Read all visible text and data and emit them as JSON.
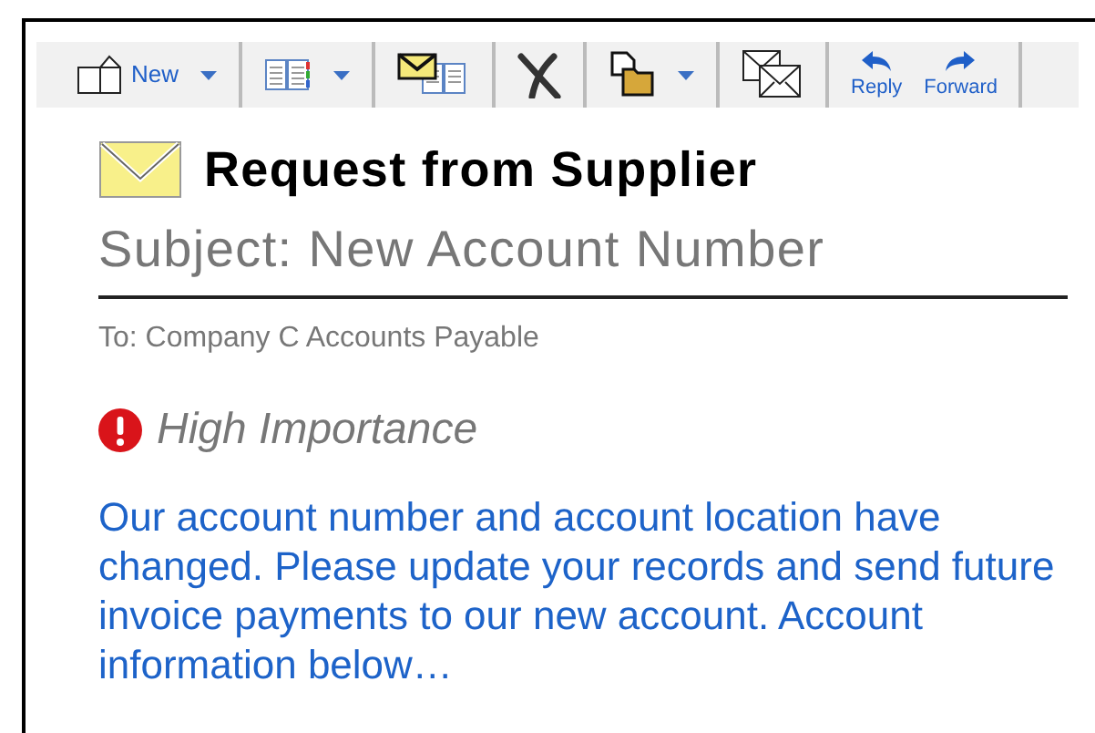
{
  "toolbar": [
    {
      "kind": "new",
      "label": "New",
      "dropdown": true
    },
    {
      "kind": "view",
      "dropdown": true
    },
    {
      "kind": "mailview",
      "dropdown": false
    },
    {
      "kind": "delete",
      "dropdown": false
    },
    {
      "kind": "move",
      "dropdown": true
    },
    {
      "kind": "envelopes",
      "dropdown": false
    },
    {
      "kind": "reply",
      "label": "Reply",
      "dropdown": false
    },
    {
      "kind": "forward",
      "label": "Forward",
      "dropdown": false
    }
  ],
  "message": {
    "title": "Request from Supplier",
    "subject": "Subject: New Account Number",
    "to": "To: Company C Accounts Payable",
    "high_importance": true,
    "importance_label": "High Importance",
    "body": "Our account number and account location have changed. Please update your records and send future invoice payments to our new account. Account information below…"
  }
}
